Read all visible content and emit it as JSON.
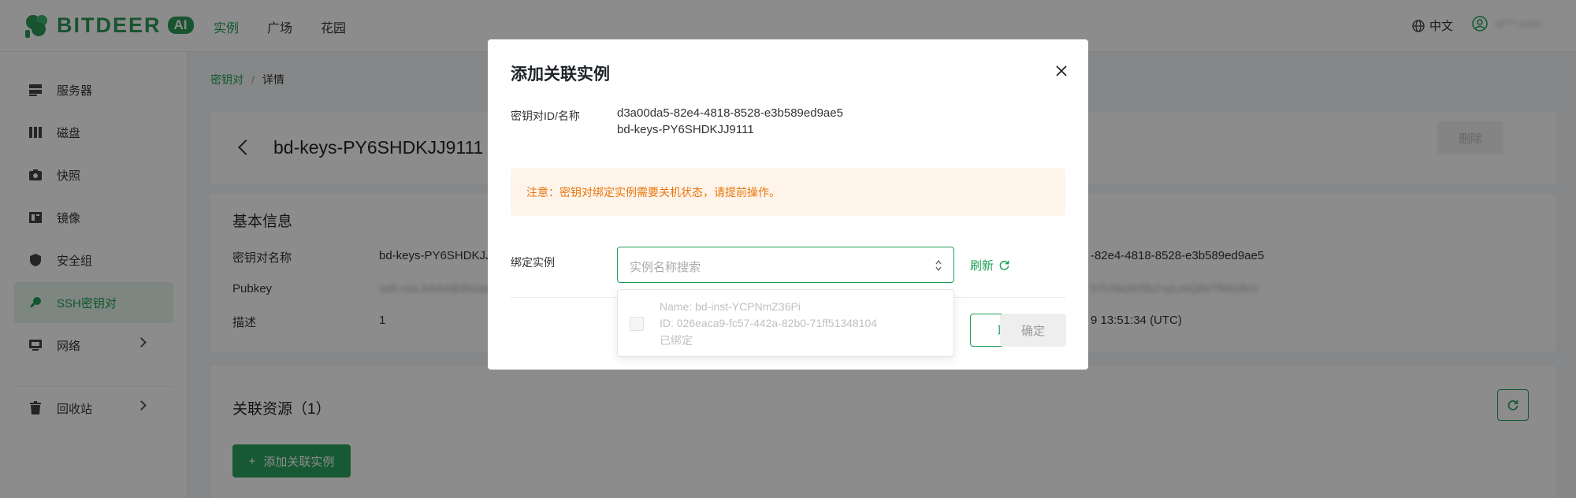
{
  "header": {
    "logo_text": "BITDEER",
    "logo_badge": "AI",
    "nav": [
      "实例",
      "广场",
      "花园"
    ],
    "active_nav": "实例",
    "language": "中文",
    "user_name": "a***.com"
  },
  "sidebar": {
    "items": [
      {
        "label": "服务器",
        "icon": "server-icon"
      },
      {
        "label": "磁盘",
        "icon": "disk-icon"
      },
      {
        "label": "快照",
        "icon": "camera-icon"
      },
      {
        "label": "镜像",
        "icon": "image-icon"
      },
      {
        "label": "安全组",
        "icon": "shield-icon"
      },
      {
        "label": "SSH密钥对",
        "icon": "key-icon",
        "active": true
      },
      {
        "label": "网络",
        "icon": "monitor-icon",
        "expandable": true
      },
      {
        "label": "回收站",
        "icon": "trash-icon",
        "expandable": true
      }
    ]
  },
  "breadcrumb": {
    "parent": "密钥对",
    "separator": "/",
    "current": "详情"
  },
  "detail": {
    "title": "bd-keys-PY6SHDKJJ9111",
    "delete_label": "删除",
    "basic_info_title": "基本信息",
    "labels": {
      "key_name": "密钥对名称",
      "pubkey": "Pubkey",
      "description": "描述"
    },
    "values": {
      "key_name": "bd-keys-PY6SHDKJJ9111",
      "pubkey": "ssh-rsa AAAAB3NzaC1yc2EAAAADAQAB",
      "description": "1",
      "id_suffix": "-82e4-4818-8528-e3b589ed9ae5",
      "pubkey_suffix": "h7U4e2K5bJ+pLmQ9sTfWx3Vz",
      "created_suffix": "9 13:51:34 (UTC)"
    },
    "related_title": "关联资源（1）",
    "add_button_label": "添加关联实例"
  },
  "modal": {
    "title": "添加关联实例",
    "id_label": "密钥对ID/名称",
    "id_value": "d3a00da5-82e4-4818-8528-e3b589ed9ae5",
    "name_value": "bd-keys-PY6SHDKJJ9111",
    "notice": "注意：密钥对绑定实例需要关机状态，请提前操作。",
    "bind_label": "绑定实例",
    "search_placeholder": "实例名称搜索",
    "refresh_label": "刷新",
    "cancel_label": "取消",
    "confirm_label": "确定",
    "option": {
      "name": "Name: bd-inst-YCPNmZ36Pi",
      "id": "ID: 026eaca9-fc57-442a-82b0-71ff51348104",
      "status": "已绑定"
    }
  },
  "colors": {
    "brand": "#1e9e55",
    "notice_bg": "#fef4ea",
    "notice_text": "#e8770e"
  }
}
